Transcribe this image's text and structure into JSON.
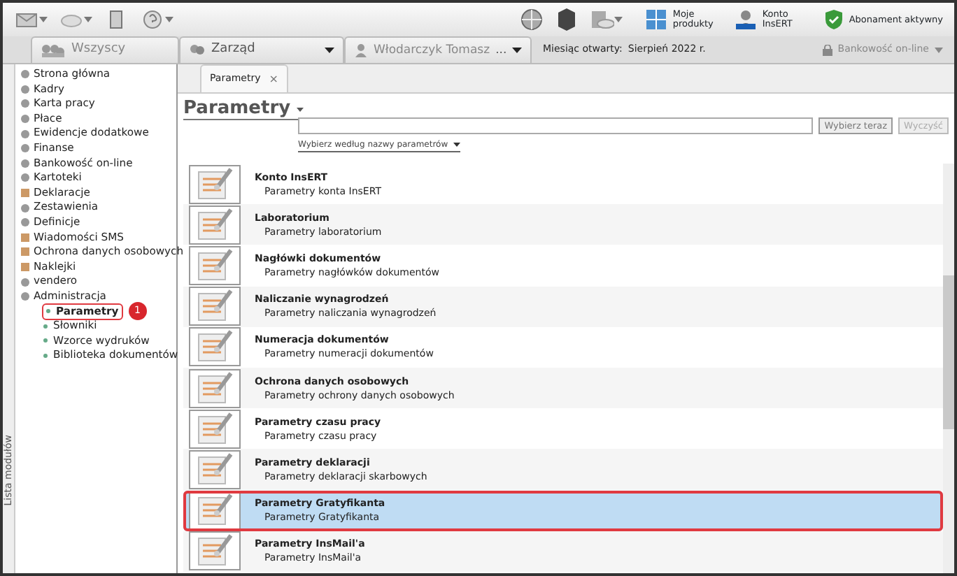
{
  "toolbar": {
    "right_items": [
      {
        "label": "Moje produkty",
        "kind": "grid"
      },
      {
        "label": "Konto InsERT",
        "kind": "person"
      },
      {
        "label": "Abonament aktywny",
        "kind": "shield"
      }
    ]
  },
  "filter_bar": {
    "group_all": "Wszyscy",
    "group": "Zarząd",
    "person": "Włodarczyk Tomasz",
    "person_more": "...",
    "month_label": "Miesiąc otwarty:",
    "month_value": "Sierpień 2022 r.",
    "banking": {
      "label": "Bankowość on-line",
      "disabled": true
    }
  },
  "sidebar": {
    "strip_label": "Lista modułów",
    "items": [
      {
        "label": "Strona główna",
        "selected": false,
        "annotated": false
      },
      {
        "label": "Kadry",
        "selected": false,
        "annotated": false
      },
      {
        "label": "Karta pracy",
        "selected": false,
        "annotated": false
      },
      {
        "label": "Płace",
        "selected": false,
        "annotated": false
      },
      {
        "label": "Ewidencje dodatkowe",
        "selected": false,
        "annotated": false
      },
      {
        "label": "Finanse",
        "selected": false,
        "annotated": false
      },
      {
        "label": "Bankowość on-line",
        "selected": false,
        "annotated": false
      },
      {
        "label": "Kartoteki",
        "selected": false,
        "annotated": false
      },
      {
        "label": "Deklaracje",
        "selected": false,
        "annotated": false
      },
      {
        "label": "Zestawienia",
        "selected": false,
        "annotated": false
      },
      {
        "label": "Definicje",
        "selected": false,
        "annotated": false
      },
      {
        "label": "Wiadomości SMS",
        "selected": false,
        "annotated": false
      },
      {
        "label": "Ochrona danych osobowych",
        "selected": false,
        "annotated": false
      },
      {
        "label": "Naklejki",
        "selected": false,
        "annotated": false
      },
      {
        "label": "vendero",
        "selected": false,
        "annotated": false
      },
      {
        "label": "Administracja",
        "selected": false,
        "annotated": false,
        "children": [
          {
            "label": "Parametry",
            "selected": true,
            "annotated": true,
            "callout": "1"
          },
          {
            "label": "Słowniki",
            "selected": false,
            "annotated": false
          },
          {
            "label": "Wzorce wydruków",
            "selected": false,
            "annotated": false
          },
          {
            "label": "Biblioteka dokumentów",
            "selected": false,
            "annotated": false
          }
        ]
      }
    ]
  },
  "tabs": [
    {
      "label": "Parametry",
      "close": "×",
      "selected": true
    }
  ],
  "page": {
    "title": "Parametry",
    "buttons": [
      {
        "label": "Wybierz teraz",
        "disabled": false
      },
      {
        "label": "Wyczyść",
        "disabled": true
      }
    ],
    "search_mode": "Wybierz według nazwy parametrów"
  },
  "parameters": [
    {
      "title": "Konto InsERT",
      "description": "Parametry konta InsERT",
      "selected": false,
      "annotated": false
    },
    {
      "title": "Laboratorium",
      "description": "Parametry laboratorium",
      "selected": false,
      "annotated": false
    },
    {
      "title": "Nagłówki dokumentów",
      "description": "Parametry nagłówków dokumentów",
      "selected": false,
      "annotated": false
    },
    {
      "title": "Naliczanie wynagrodzeń",
      "description": "Parametry naliczania wynagrodzeń",
      "selected": false,
      "annotated": false
    },
    {
      "title": "Numeracja dokumentów",
      "description": "Parametry numeracji dokumentów",
      "selected": false,
      "annotated": false
    },
    {
      "title": "Ochrona danych osobowych",
      "description": "Parametry ochrony danych osobowych",
      "selected": false,
      "annotated": false
    },
    {
      "title": "Parametry czasu pracy",
      "description": "Parametry czasu pracy",
      "selected": false,
      "annotated": false
    },
    {
      "title": "Parametry deklaracji",
      "description": "Parametry deklaracji skarbowych",
      "selected": false,
      "annotated": false
    },
    {
      "title": "Parametry Gratyfikanta",
      "description": "Parametry Gratyfikanta",
      "selected": true,
      "annotated": true
    },
    {
      "title": "Parametry InsMail'a",
      "description": "Parametry InsMail'a",
      "selected": false,
      "annotated": false
    }
  ]
}
